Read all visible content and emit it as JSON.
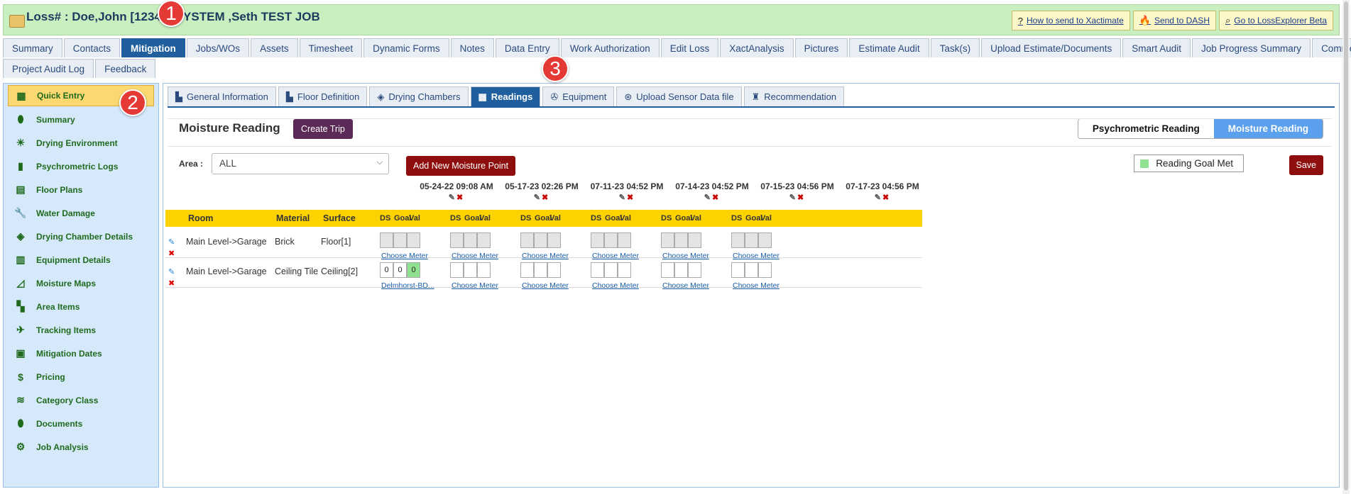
{
  "header": {
    "title": "Loss# : Doe,John [1234 ] ,SYSTEM ,Seth TEST JOB",
    "links": [
      {
        "icon": "question-circle-icon",
        "glyph": "?",
        "label": "How to send to Xactimate"
      },
      {
        "icon": "flame-icon",
        "glyph": "🔥",
        "label": "Send to DASH"
      },
      {
        "icon": "binoculars-icon",
        "glyph": "⌕",
        "label": "Go to LossExplorer Beta"
      }
    ]
  },
  "tabs_row1": [
    "Summary",
    "Contacts",
    "Mitigation",
    "Jobs/WOs",
    "Assets",
    "Timesheet",
    "Dynamic Forms",
    "Notes",
    "Data Entry",
    "Work Authorization",
    "Edit Loss",
    "XactAnalysis",
    "Pictures",
    "Estimate Audit",
    "Task(s)",
    "Upload Estimate/Documents",
    "Smart Audit",
    "Job Progress Summary",
    "Commercial"
  ],
  "tabs_row2": [
    "Project Audit Log",
    "Feedback"
  ],
  "active_tab": "Mitigation",
  "sidebar": [
    {
      "label": "Quick Entry",
      "icon": "grid-icon",
      "glyph": "▦"
    },
    {
      "label": "Summary",
      "icon": "jar-icon",
      "glyph": "⬮"
    },
    {
      "label": "Drying Environment",
      "icon": "weather-icon",
      "glyph": "☀"
    },
    {
      "label": "Psychrometric Logs",
      "icon": "bar-chart-icon",
      "glyph": "▮"
    },
    {
      "label": "Floor Plans",
      "icon": "floor-plan-icon",
      "glyph": "▤"
    },
    {
      "label": "Water Damage",
      "icon": "wrench-icon",
      "glyph": "🔧"
    },
    {
      "label": "Drying Chamber Details",
      "icon": "box-icon",
      "glyph": "◈"
    },
    {
      "label": "Equipment Details",
      "icon": "clipboard-icon",
      "glyph": "▥"
    },
    {
      "label": "Moisture Maps",
      "icon": "line-chart-icon",
      "glyph": "◿"
    },
    {
      "label": "Area Items",
      "icon": "blocks-icon",
      "glyph": "▚"
    },
    {
      "label": "Tracking Items",
      "icon": "tracking-icon",
      "glyph": "✈"
    },
    {
      "label": "Mitigation Dates",
      "icon": "calendar-icon",
      "glyph": "▣"
    },
    {
      "label": "Pricing",
      "icon": "dollar-icon",
      "glyph": "$"
    },
    {
      "label": "Category Class",
      "icon": "coins-icon",
      "glyph": "≋"
    },
    {
      "label": "Documents",
      "icon": "document-jar-icon",
      "glyph": "⬮"
    },
    {
      "label": "Job Analysis",
      "icon": "analysis-icon",
      "glyph": "⚙"
    }
  ],
  "subtabs": [
    {
      "label": "General Information",
      "icon": "info-icon",
      "glyph": "▙"
    },
    {
      "label": "Floor Definition",
      "icon": "floor-icon",
      "glyph": "▙"
    },
    {
      "label": "Drying Chambers",
      "icon": "chamber-icon",
      "glyph": "◈"
    },
    {
      "label": "Readings",
      "icon": "readings-icon",
      "glyph": "▦"
    },
    {
      "label": "Equipment",
      "icon": "fan-icon",
      "glyph": "✇"
    },
    {
      "label": "Upload Sensor Data file",
      "icon": "sensor-icon",
      "glyph": "⊛"
    },
    {
      "label": "Recommendation",
      "icon": "recommend-icon",
      "glyph": "♜"
    }
  ],
  "active_subtab": "Readings",
  "main": {
    "title": "Moisture Reading",
    "create_trip": "Create Trip",
    "toggle_off": "Psychrometric Reading",
    "toggle_on": "Moisture Reading",
    "area_label": "Area :",
    "area_value": "ALL",
    "add_point": "Add New Moisture Point",
    "goal_legend": "Reading Goal Met",
    "save": "Save"
  },
  "dates": [
    "05-24-22 09:08 AM",
    "05-17-23 02:26 PM",
    "07-11-23 04:52 PM",
    "07-14-23 04:52 PM",
    "07-15-23 04:56 PM",
    "07-17-23 04:56 PM"
  ],
  "table_head": {
    "room": "Room",
    "material": "Material",
    "surface": "Surface",
    "ds": "DS",
    "goal": "Goal",
    "val": "Val"
  },
  "rows": [
    {
      "room": "Main Level->Garage",
      "material": "Brick",
      "surface": "Floor[1]",
      "readings": [
        {
          "cells": [
            "",
            "",
            ""
          ],
          "meter": "Choose Meter",
          "style": "empty"
        },
        {
          "cells": [
            "",
            "",
            ""
          ],
          "meter": "Choose Meter",
          "style": "empty"
        },
        {
          "cells": [
            "",
            "",
            ""
          ],
          "meter": "Choose Meter",
          "style": "empty"
        },
        {
          "cells": [
            "",
            "",
            ""
          ],
          "meter": "Choose Meter",
          "style": "empty"
        },
        {
          "cells": [
            "",
            "",
            ""
          ],
          "meter": "Choose Meter",
          "style": "empty"
        },
        {
          "cells": [
            "",
            "",
            ""
          ],
          "meter": "Choose Meter",
          "style": "empty"
        }
      ]
    },
    {
      "room": "Main Level->Garage",
      "material": "Ceiling Tile",
      "surface": "Ceiling[2]",
      "readings": [
        {
          "cells": [
            "0",
            "0",
            "0"
          ],
          "meter": "Delmhorst-BD...",
          "style": "filled"
        },
        {
          "cells": [
            "",
            "",
            ""
          ],
          "meter": "Choose Meter",
          "style": "blank"
        },
        {
          "cells": [
            "",
            "",
            ""
          ],
          "meter": "Choose Meter",
          "style": "blank"
        },
        {
          "cells": [
            "",
            "",
            ""
          ],
          "meter": "Choose Meter",
          "style": "blank"
        },
        {
          "cells": [
            "",
            "",
            ""
          ],
          "meter": "Choose Meter",
          "style": "blank"
        },
        {
          "cells": [
            "",
            "",
            ""
          ],
          "meter": "Choose Meter",
          "style": "blank"
        }
      ]
    }
  ],
  "badges": [
    "1",
    "2",
    "3"
  ]
}
